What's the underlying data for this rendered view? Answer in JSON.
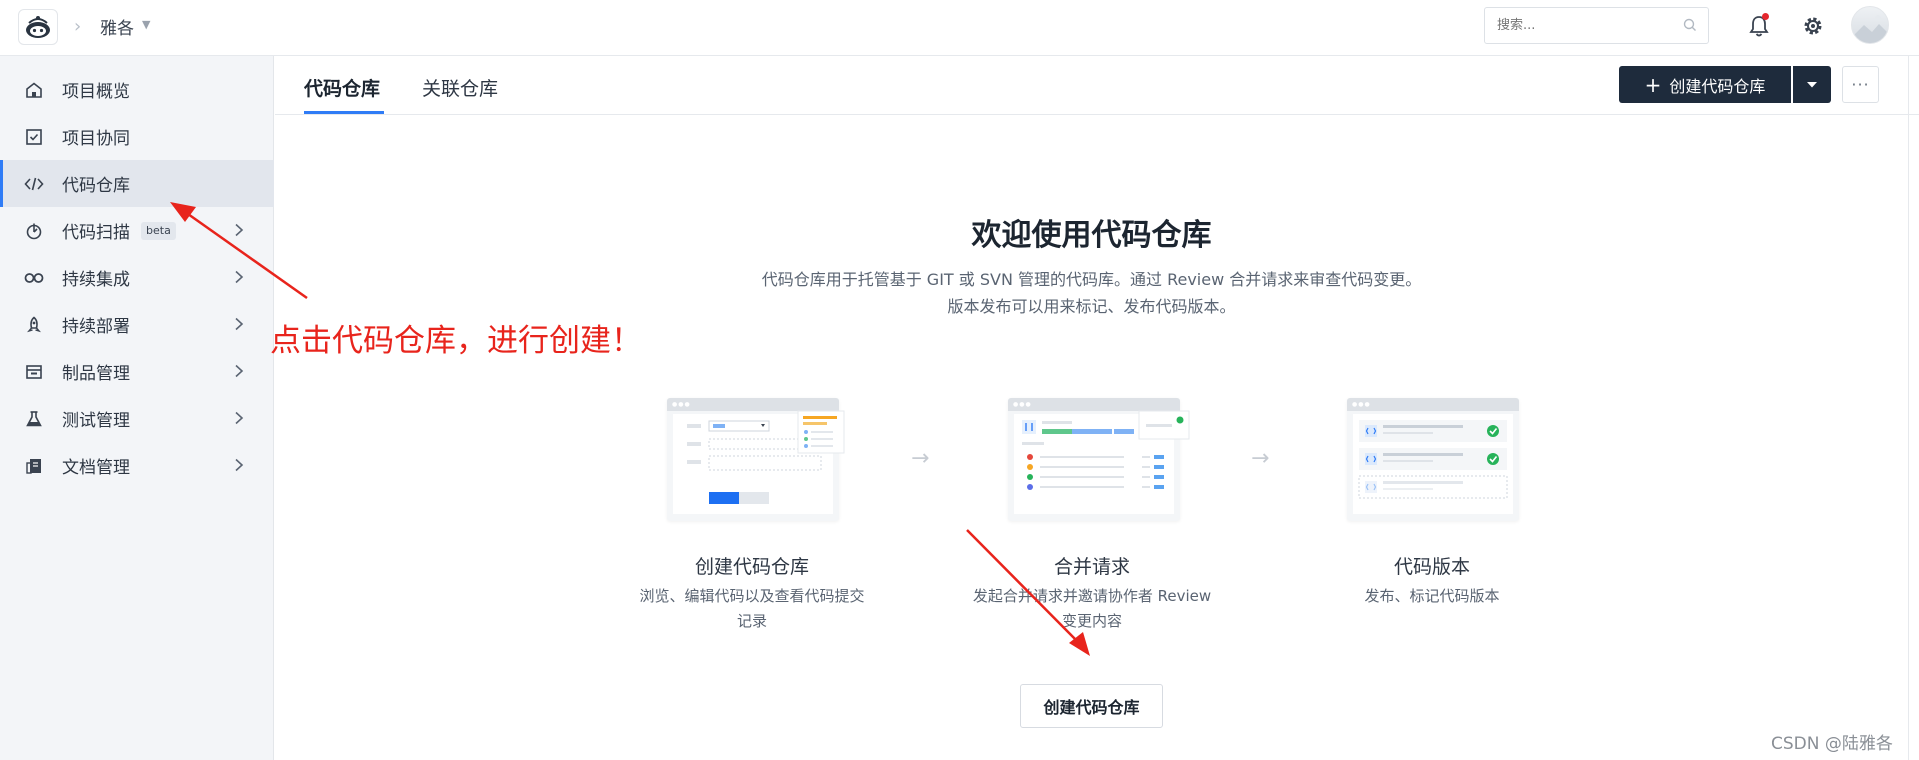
{
  "topbar": {
    "project_name": "雅各",
    "search_placeholder": "搜索..."
  },
  "sidebar": {
    "items": [
      {
        "label": "项目概览",
        "icon": "home-icon"
      },
      {
        "label": "项目协同",
        "icon": "checkbox-board-icon"
      },
      {
        "label": "代码仓库",
        "icon": "code-icon",
        "active": true
      },
      {
        "label": "代码扫描",
        "icon": "scan-icon",
        "badge": "beta"
      },
      {
        "label": "持续集成",
        "icon": "infinity-icon"
      },
      {
        "label": "持续部署",
        "icon": "rocket-icon"
      },
      {
        "label": "制品管理",
        "icon": "package-icon"
      },
      {
        "label": "测试管理",
        "icon": "flask-icon"
      },
      {
        "label": "文档管理",
        "icon": "document-icon"
      }
    ]
  },
  "tabs": [
    {
      "label": "代码仓库",
      "active": true
    },
    {
      "label": "关联仓库"
    }
  ],
  "toolbar": {
    "create_label": "创建代码仓库"
  },
  "hero": {
    "title": "欢迎使用代码仓库",
    "desc_line1": "代码仓库用于托管基于 GIT 或 SVN 管理的代码库。通过 Review 合并请求来审查代码变更。",
    "desc_line2": "版本发布可以用来标记、发布代码版本。"
  },
  "cards": [
    {
      "title": "创建代码仓库",
      "desc_line1": "浏览、编辑代码以及查看代码提交",
      "desc_line2": "记录"
    },
    {
      "title": "合并请求",
      "desc_line1": "发起合并请求并邀请协作者 Review",
      "desc_line2": "变更内容"
    },
    {
      "title": "代码版本",
      "desc_line1": "发布、标记代码版本",
      "desc_line2": ""
    }
  ],
  "bottom_button": "创建代码仓库",
  "annotation": "点击代码仓库，进行创建！",
  "watermark": "CSDN @陆雅各",
  "colors": {
    "accent": "#2f7cf6",
    "dark_button": "#1e2b3c",
    "annotation": "#e8241c",
    "success": "#27b35a"
  }
}
